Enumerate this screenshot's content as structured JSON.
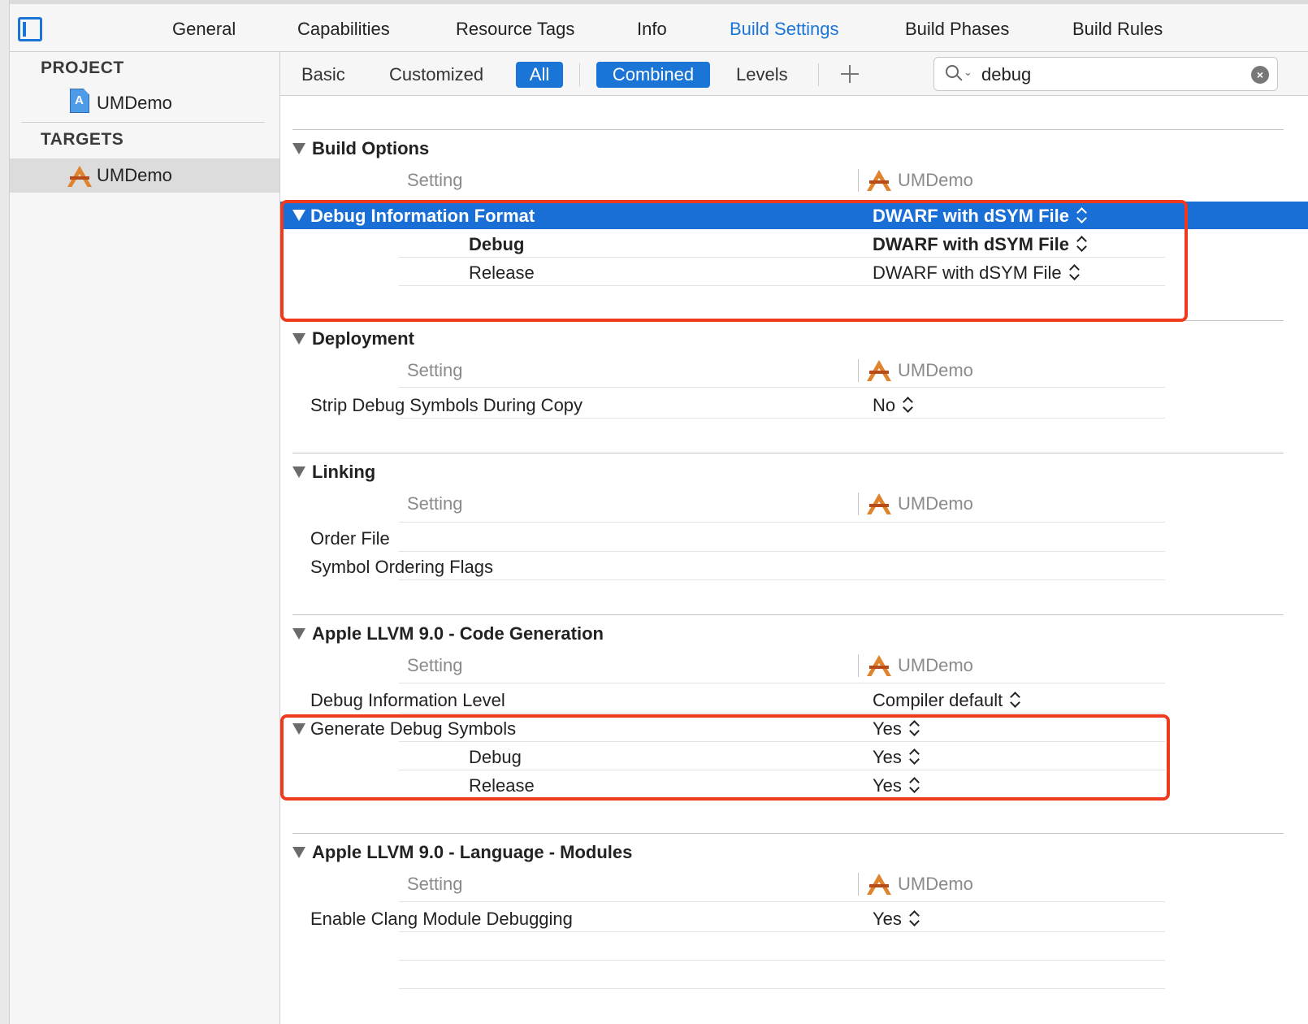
{
  "tabs": [
    {
      "label": "General",
      "active": false
    },
    {
      "label": "Capabilities",
      "active": false
    },
    {
      "label": "Resource Tags",
      "active": false
    },
    {
      "label": "Info",
      "active": false
    },
    {
      "label": "Build Settings",
      "active": true
    },
    {
      "label": "Build Phases",
      "active": false
    },
    {
      "label": "Build Rules",
      "active": false
    }
  ],
  "navigator": {
    "project_header": "PROJECT",
    "project_item": "UMDemo",
    "targets_header": "TARGETS",
    "target_item": "UMDemo"
  },
  "filters": {
    "basic": "Basic",
    "customized": "Customized",
    "all": "All",
    "combined": "Combined",
    "levels": "Levels"
  },
  "search": {
    "value": "debug"
  },
  "column": {
    "setting": "Setting",
    "target": "UMDemo"
  },
  "sections": {
    "build_options": {
      "title": "Build Options",
      "setting": {
        "name": "Debug Information Format",
        "value": "DWARF with dSYM File"
      },
      "debug": {
        "label": "Debug",
        "value": "DWARF with dSYM File"
      },
      "release": {
        "label": "Release",
        "value": "DWARF with dSYM File"
      }
    },
    "deployment": {
      "title": "Deployment",
      "strip": {
        "name": "Strip Debug Symbols During Copy",
        "value": "No"
      }
    },
    "linking": {
      "title": "Linking",
      "order_file": "Order File",
      "symbol_ordering": "Symbol Ordering Flags"
    },
    "codegen": {
      "title": "Apple LLVM 9.0 - Code Generation",
      "debug_level": {
        "name": "Debug Information Level",
        "value": "Compiler default"
      },
      "gen_symbols": {
        "name": "Generate Debug Symbols",
        "value": "Yes"
      },
      "debug": {
        "label": "Debug",
        "value": "Yes"
      },
      "release": {
        "label": "Release",
        "value": "Yes"
      }
    },
    "modules": {
      "title": "Apple LLVM 9.0 - Language - Modules",
      "clang_debug": {
        "name": "Enable Clang Module Debugging",
        "value": "Yes"
      }
    }
  },
  "colors": {
    "accent": "#1a75d6",
    "highlight": "#f03a1e"
  }
}
